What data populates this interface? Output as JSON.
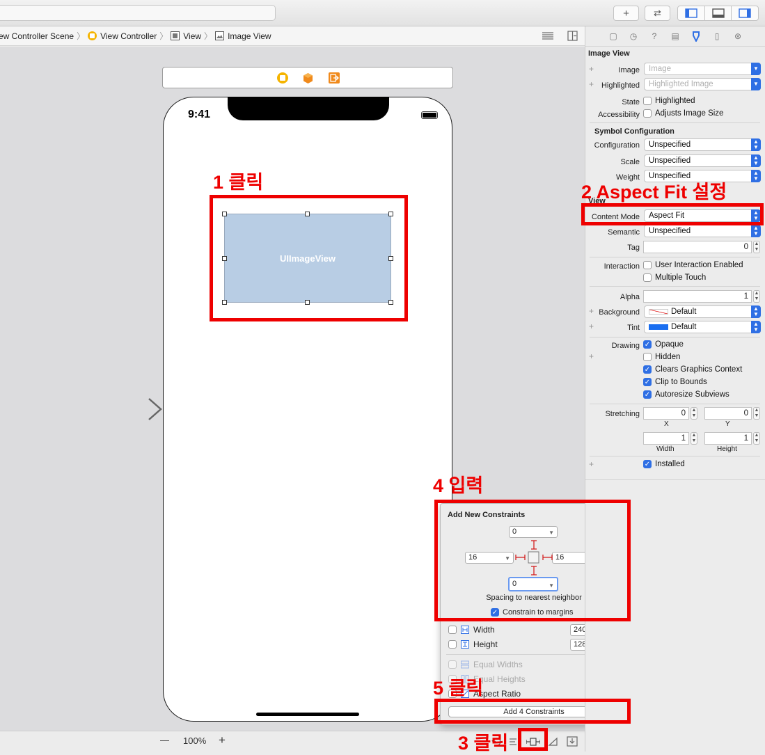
{
  "toolbar": {
    "add_label": "+",
    "swap_label": "⇄"
  },
  "breadcrumb": {
    "items": [
      "ew Controller Scene",
      "View Controller",
      "View",
      "Image View"
    ]
  },
  "phone": {
    "time": "9:41",
    "image_view_label": "UIImageView"
  },
  "annotations": {
    "step1": "1 클릭",
    "step2": "2 Aspect Fit 설정",
    "step3": "3 클릭",
    "step4": "4 입력",
    "step5": "5 클릭"
  },
  "bottom": {
    "zoom": "100%",
    "zoom_out": "—",
    "zoom_in": "+"
  },
  "constraints_popover": {
    "title": "Add New Constraints",
    "top": "0",
    "leading": "16",
    "trailing": "16",
    "bottom": "0",
    "spacing_label": "Spacing to nearest neighbor",
    "constrain_to_margins": "Constrain to margins",
    "width_label": "Width",
    "width_value": "240",
    "height_label": "Height",
    "height_value": "128",
    "equal_widths": "Equal Widths",
    "equal_heights": "Equal Heights",
    "aspect_ratio": "Aspect Ratio",
    "add_button": "Add 4 Constraints"
  },
  "inspector": {
    "section_title": "Image View",
    "image_label": "Image",
    "image_placeholder": "Image",
    "highlighted_label": "Highlighted",
    "highlighted_placeholder": "Highlighted Image",
    "state_label": "State",
    "state_check": "Highlighted",
    "accessibility_label": "Accessibility",
    "accessibility_check": "Adjusts Image Size",
    "symbol_config_title": "Symbol Configuration",
    "configuration_label": "Configuration",
    "configuration_value": "Unspecified",
    "scale_label": "Scale",
    "scale_value": "Unspecified",
    "weight_label": "Weight",
    "weight_value": "Unspecified",
    "view_title": "View",
    "content_mode_label": "Content Mode",
    "content_mode_value": "Aspect Fit",
    "semantic_label": "Semantic",
    "semantic_value": "Unspecified",
    "tag_label": "Tag",
    "tag_value": "0",
    "interaction_label": "Interaction",
    "user_interaction": "User Interaction Enabled",
    "multiple_touch": "Multiple Touch",
    "alpha_label": "Alpha",
    "alpha_value": "1",
    "background_label": "Background",
    "background_value": "Default",
    "tint_label": "Tint",
    "tint_value": "Default",
    "drawing_label": "Drawing",
    "opaque": "Opaque",
    "hidden": "Hidden",
    "clears_graphics": "Clears Graphics Context",
    "clip_to_bounds": "Clip to Bounds",
    "autoresize": "Autoresize Subviews",
    "stretching_label": "Stretching",
    "stretch_x": "0",
    "stretch_y": "0",
    "stretch_w": "1",
    "stretch_h": "1",
    "x_label": "X",
    "y_label": "Y",
    "width_label": "Width",
    "height_label": "Height",
    "installed": "Installed"
  },
  "colors": {
    "annotation_red": "#ee0000",
    "accent_blue": "#2f6fe4",
    "image_view_fill": "#b8cde4"
  }
}
